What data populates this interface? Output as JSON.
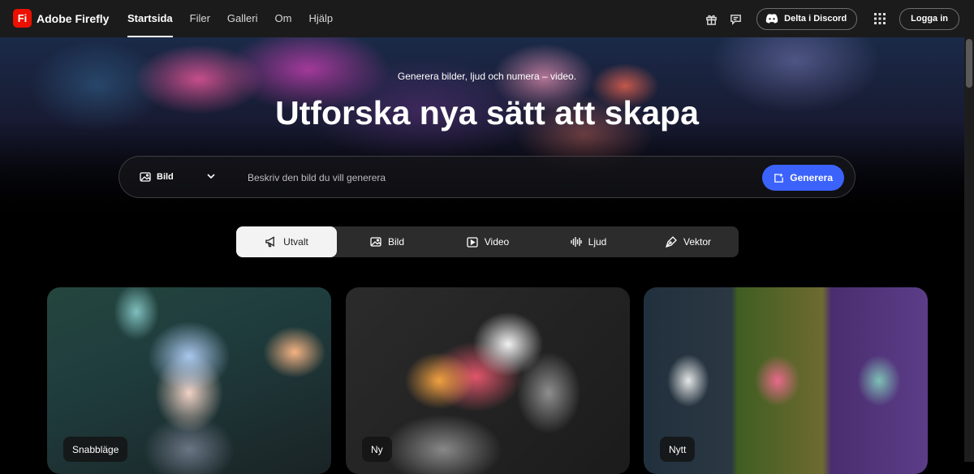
{
  "brand": {
    "logo_text": "Fi",
    "name": "Adobe Firefly",
    "color": "#eb1000"
  },
  "nav": {
    "items": [
      {
        "label": "Startsida",
        "active": true
      },
      {
        "label": "Filer",
        "active": false
      },
      {
        "label": "Galleri",
        "active": false
      },
      {
        "label": "Om",
        "active": false
      },
      {
        "label": "Hjälp",
        "active": false
      }
    ]
  },
  "header_tools": {
    "icons": [
      "gift-icon",
      "chat-icon",
      "apps-grid-icon"
    ],
    "discord_label": "Delta i Discord",
    "login_label": "Logga in"
  },
  "hero": {
    "subtitle": "Generera bilder, ljud och numera – video.",
    "title": "Utforska nya sätt att skapa",
    "prompt": {
      "mode_label": "Bild",
      "placeholder": "Beskriv den bild du vill generera",
      "generate_label": "Generera",
      "accent": "#3b63fb"
    }
  },
  "tabs": [
    {
      "label": "Utvalt",
      "icon": "megaphone-icon",
      "active": true
    },
    {
      "label": "Bild",
      "icon": "image-icon",
      "active": false
    },
    {
      "label": "Video",
      "icon": "video-icon",
      "active": false
    },
    {
      "label": "Ljud",
      "icon": "audio-wave-icon",
      "active": false
    },
    {
      "label": "Vektor",
      "icon": "pen-icon",
      "active": false
    }
  ],
  "cards": [
    {
      "badge": "Snabbläge"
    },
    {
      "badge": "Ny"
    },
    {
      "badge": "Nytt"
    }
  ]
}
